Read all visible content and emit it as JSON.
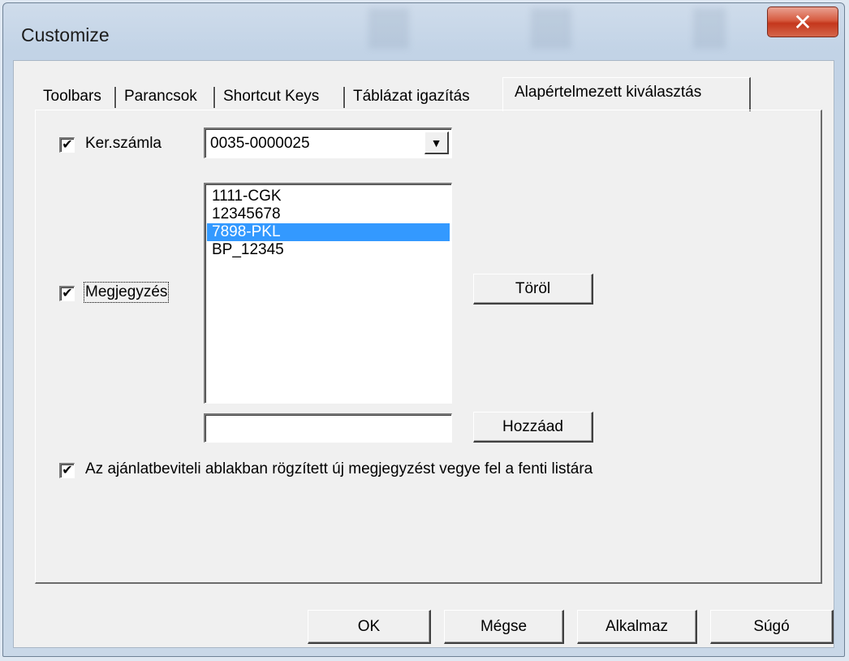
{
  "window": {
    "title": "Customize",
    "close_glyph": "✕"
  },
  "tabs": [
    {
      "label": "Toolbars"
    },
    {
      "label": "Parancsok"
    },
    {
      "label": "Shortcut Keys"
    },
    {
      "label": "Táblázat igazítás"
    },
    {
      "label": "Alapértelmezett kiválasztás",
      "active": true
    }
  ],
  "panel": {
    "ker_szamla": {
      "checked": true,
      "label": "Ker.számla",
      "combo_value": "0035-0000025"
    },
    "megjegyzes": {
      "checked": true,
      "label": "Megjegyzés",
      "list_items": [
        "1111-CGK",
        "12345678",
        "7898-PKL",
        "BP_12345"
      ],
      "selected_item": "7898-PKL",
      "new_item_value": "",
      "delete_button": "Töröl",
      "add_button": "Hozzáad"
    },
    "auto_add": {
      "checked": true,
      "label": "Az ajánlatbeviteli ablakban rögzített új megjegyzést vegye fel a fenti listára"
    },
    "check_glyph": "✔"
  },
  "footer": {
    "ok": "OK",
    "cancel": "Mégse",
    "apply": "Alkalmaz",
    "help": "Súgó"
  },
  "colors": {
    "selection": "#3399ff",
    "close_button": "#c4371c",
    "face": "#f0f0f0"
  },
  "icons": {
    "close": "close-icon",
    "combo_arrow": "chevron-down-icon",
    "check": "checkmark-icon"
  }
}
